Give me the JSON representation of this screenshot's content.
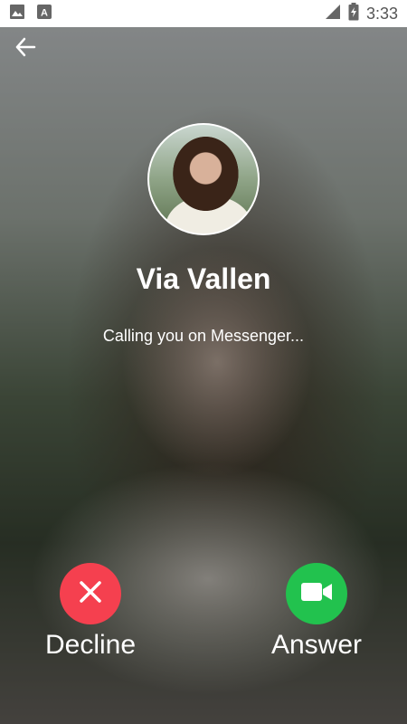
{
  "status_bar": {
    "time": "3:33",
    "icons": [
      "image-icon",
      "font-icon",
      "signal-icon",
      "battery-icon"
    ]
  },
  "header": {
    "back_icon": "back-arrow-icon"
  },
  "caller": {
    "name": "Via Vallen",
    "status": "Calling you on Messenger..."
  },
  "actions": {
    "decline_label": "Decline",
    "answer_label": "Answer"
  },
  "colors": {
    "decline": "#f5404f",
    "answer": "#22c24e",
    "status_bar_bg": "#ffffff",
    "text": "#ffffff"
  }
}
